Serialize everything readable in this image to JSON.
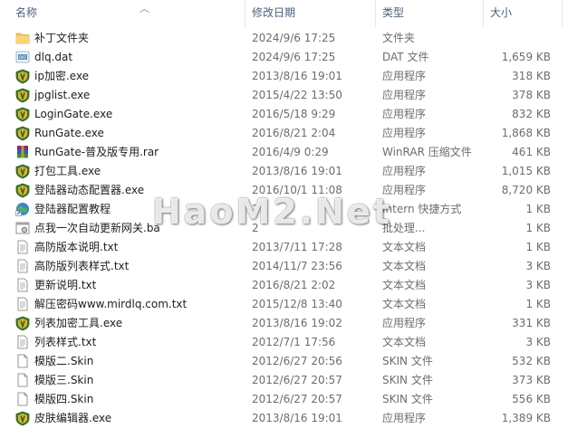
{
  "columns": {
    "name": "名称",
    "modified": "修改日期",
    "type": "类型",
    "size": "大小"
  },
  "files": [
    {
      "name": "补丁文件夹",
      "modified": "2024/9/6 17:25",
      "type": "文件夹",
      "size": "",
      "icon": "folder-icon"
    },
    {
      "name": "dlq.dat",
      "modified": "2024/9/6 17:25",
      "type": "DAT 文件",
      "size": "1,659 KB",
      "icon": "dat-file-icon"
    },
    {
      "name": "ip加密.exe",
      "modified": "2013/8/16 19:01",
      "type": "应用程序",
      "size": "318 KB",
      "icon": "shield-icon"
    },
    {
      "name": "jpglist.exe",
      "modified": "2015/4/22 13:50",
      "type": "应用程序",
      "size": "378 KB",
      "icon": "shield-icon"
    },
    {
      "name": "LoginGate.exe",
      "modified": "2016/5/18 9:29",
      "type": "应用程序",
      "size": "832 KB",
      "icon": "shield-icon"
    },
    {
      "name": "RunGate.exe",
      "modified": "2016/8/21 2:04",
      "type": "应用程序",
      "size": "1,868 KB",
      "icon": "shield-icon"
    },
    {
      "name": "RunGate-普及版专用.rar",
      "modified": "2016/4/9 0:29",
      "type": "WinRAR 压缩文件",
      "size": "461 KB",
      "icon": "rar-archive-icon"
    },
    {
      "name": "打包工具.exe",
      "modified": "2013/8/16 19:01",
      "type": "应用程序",
      "size": "1,015 KB",
      "icon": "shield-icon"
    },
    {
      "name": "登陆器动态配置器.exe",
      "modified": "2016/10/1 11:08",
      "type": "应用程序",
      "size": "8,720 KB",
      "icon": "shield-icon"
    },
    {
      "name": "登陆器配置教程",
      "modified": "2",
      "type": "Intern 快捷方式",
      "size": "1 KB",
      "icon": "internet-shortcut-icon"
    },
    {
      "name": "点我一次自动更新网关.ba",
      "modified": "2",
      "type": "批处理...",
      "size": "1 KB",
      "icon": "batch-file-icon"
    },
    {
      "name": "高防版本说明.txt",
      "modified": "2013/7/11 17:28",
      "type": "文本文档",
      "size": "1 KB",
      "icon": "text-file-icon"
    },
    {
      "name": "高防版列表样式.txt",
      "modified": "2014/11/7 23:56",
      "type": "文本文档",
      "size": "3 KB",
      "icon": "text-file-icon"
    },
    {
      "name": "更新说明.txt",
      "modified": "2016/8/21 2:02",
      "type": "文本文档",
      "size": "3 KB",
      "icon": "text-file-icon"
    },
    {
      "name": "解压密码www.mirdlq.com.txt",
      "modified": "2015/12/8 13:40",
      "type": "文本文档",
      "size": "1 KB",
      "icon": "text-file-icon"
    },
    {
      "name": "列表加密工具.exe",
      "modified": "2013/8/16 19:02",
      "type": "应用程序",
      "size": "331 KB",
      "icon": "shield-icon"
    },
    {
      "name": "列表样式.txt",
      "modified": "2012/7/1 17:56",
      "type": "文本文档",
      "size": "3 KB",
      "icon": "text-file-icon"
    },
    {
      "name": "模版二.Skin",
      "modified": "2012/6/27 20:56",
      "type": "SKIN 文件",
      "size": "532 KB",
      "icon": "blank-file-icon"
    },
    {
      "name": "模版三.Skin",
      "modified": "2012/6/27 20:57",
      "type": "SKIN 文件",
      "size": "373 KB",
      "icon": "blank-file-icon"
    },
    {
      "name": "模版四.Skin",
      "modified": "2012/6/27 20:57",
      "type": "SKIN 文件",
      "size": "556 KB",
      "icon": "blank-file-icon"
    },
    {
      "name": "皮肤编辑器.exe",
      "modified": "2013/8/16 19:01",
      "type": "应用程序",
      "size": "1,389 KB",
      "icon": "shield-icon"
    }
  ],
  "watermark": "HaoM2.Net",
  "colors": {
    "header_text": "#4c607a",
    "folder": "#f2c55c",
    "shield_green": "#3f7d2b",
    "shield_gold": "#d7b13a",
    "secondary_text": "#6d6d6d"
  }
}
